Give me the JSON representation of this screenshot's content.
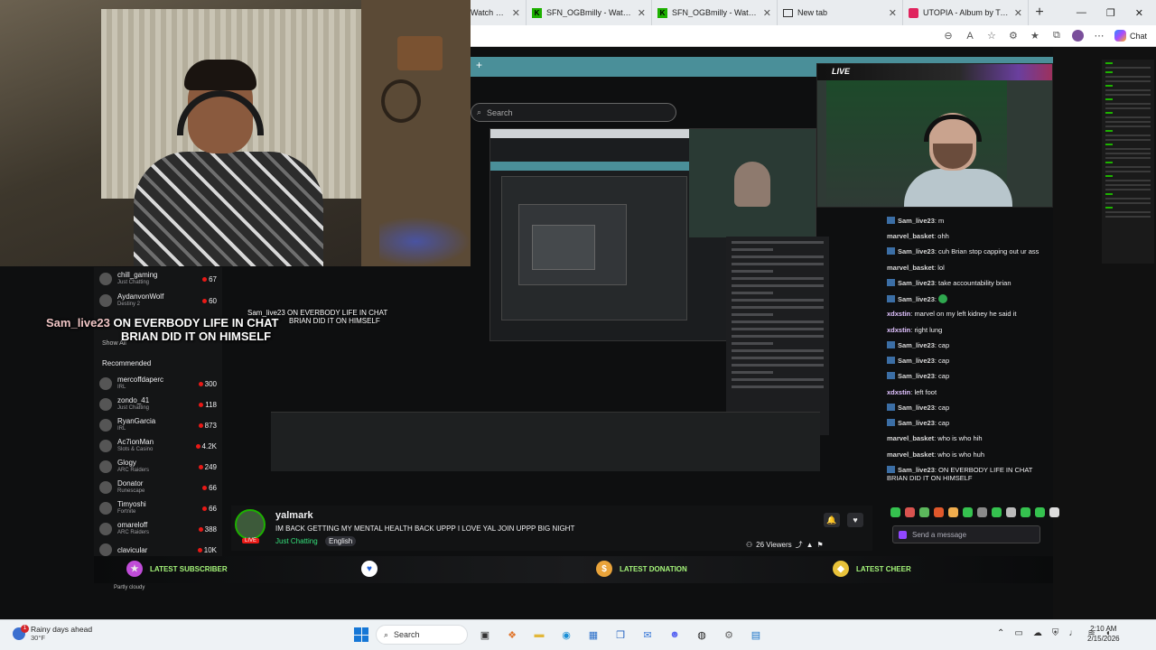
{
  "browser": {
    "tabs": [
      {
        "title": "Watch clips",
        "favicon": "kick-icon"
      },
      {
        "title": "SFN_OGBmilly - Watch clips",
        "favicon": "kick-icon"
      },
      {
        "title": "SFN_OGBmilly - Watch clips",
        "favicon": "kick-icon"
      },
      {
        "title": "New tab",
        "favicon": "newtab-icon"
      },
      {
        "title": "UTOPIA - Album by Travis Sc",
        "favicon": "utopia-icon"
      }
    ],
    "chat_label": "Chat"
  },
  "stream": {
    "search_placeholder": "Search",
    "live_label": "LIVE",
    "overlay_message": {
      "user": "Sam_live23",
      "line1": "ON EVERBODY LIFE IN CHAT",
      "line2": "BRIAN DID IT ON HIMSELF"
    },
    "nested_overlay": {
      "line1": "Sam_live23 ON EVERBODY LIFE IN CHAT",
      "line2": "BRIAN DID IT ON HIMSELF"
    },
    "recommended": {
      "top": [
        {
          "name": "chill_gaming",
          "category": "Just Chatting",
          "viewers": "67"
        },
        {
          "name": "AydanvonWolf",
          "category": "Destiny 2",
          "viewers": "60"
        }
      ],
      "show_all": "Show All",
      "heading": "Recommended",
      "items": [
        {
          "name": "mercoffdaperc",
          "category": "IRL",
          "viewers": "300"
        },
        {
          "name": "zondo_41",
          "category": "Just Chatting",
          "viewers": "118"
        },
        {
          "name": "RyanGarcia",
          "category": "IRL",
          "viewers": "873"
        },
        {
          "name": "Ac7ionMan",
          "category": "Slots & Casino",
          "viewers": "4.2K"
        },
        {
          "name": "Glogy",
          "category": "ARC Raiders",
          "viewers": "249"
        },
        {
          "name": "Donator",
          "category": "Runescape",
          "viewers": "66"
        },
        {
          "name": "Timyoshi",
          "category": "Fortnite",
          "viewers": "66"
        },
        {
          "name": "omareloff",
          "category": "ARC Raiders",
          "viewers": "388"
        },
        {
          "name": "clavicular",
          "category": "",
          "viewers": "10K"
        }
      ]
    },
    "chat": [
      {
        "user": "Sam_live23",
        "msg": "m",
        "badge": true
      },
      {
        "user": "marvel_basket",
        "msg": "ohh",
        "badge": false
      },
      {
        "user": "Sam_live23",
        "msg": "cuh Brian stop capping out ur ass",
        "badge": true
      },
      {
        "user": "marvel_basket",
        "msg": "lol",
        "badge": false
      },
      {
        "user": "Sam_live23",
        "msg": "take accountability brian",
        "badge": true
      },
      {
        "user": "Sam_live23",
        "msg": "",
        "badge": true,
        "emote": true
      },
      {
        "user": "xdxstin",
        "msg": "marvel on my left kidney he said it",
        "badge": false
      },
      {
        "user": "xdxstin",
        "msg": "right lung",
        "badge": false
      },
      {
        "user": "Sam_live23",
        "msg": "cap",
        "badge": true
      },
      {
        "user": "Sam_live23",
        "msg": "cap",
        "badge": true
      },
      {
        "user": "Sam_live23",
        "msg": "cap",
        "badge": true
      },
      {
        "user": "xdxstin",
        "msg": "left foot",
        "badge": false
      },
      {
        "user": "Sam_live23",
        "msg": "cap",
        "badge": true
      },
      {
        "user": "Sam_live23",
        "msg": "cap",
        "badge": true
      },
      {
        "user": "marvel_basket",
        "msg": "who is who hih",
        "badge": false
      },
      {
        "user": "marvel_basket",
        "msg": "who is who huh",
        "badge": false
      },
      {
        "user": "Sam_live23",
        "msg": "ON EVERBODY LIFE IN CHAT BRIAN DID IT ON HIMSELF",
        "badge": true
      }
    ],
    "send_placeholder": "Send a message",
    "streamer": {
      "name": "yalmark",
      "title": "IM BACK GETTING MY MENTAL HEALTH BACK UPPP I LOVE YAL JOIN UPPP BIG NIGHT",
      "category": "Just Chatting",
      "language": "English",
      "live_badge": "LIVE",
      "viewers": "26 Viewers"
    },
    "alerts": {
      "subscriber": "LATEST SUBSCRIBER",
      "donation": "LATEST DONATION",
      "cheer": "LATEST CHEER"
    },
    "weather_small": "Partly cloudy"
  },
  "taskbar": {
    "weather_title": "Rainy days ahead",
    "weather_temp": "30°F",
    "notification_count": "1",
    "search_label": "Search",
    "time": "2:10 AM",
    "date": "2/15/2026"
  },
  "colors": {
    "kick_green": "#53fc18",
    "teal": "#4a8f99",
    "live_red": "#e91916"
  }
}
